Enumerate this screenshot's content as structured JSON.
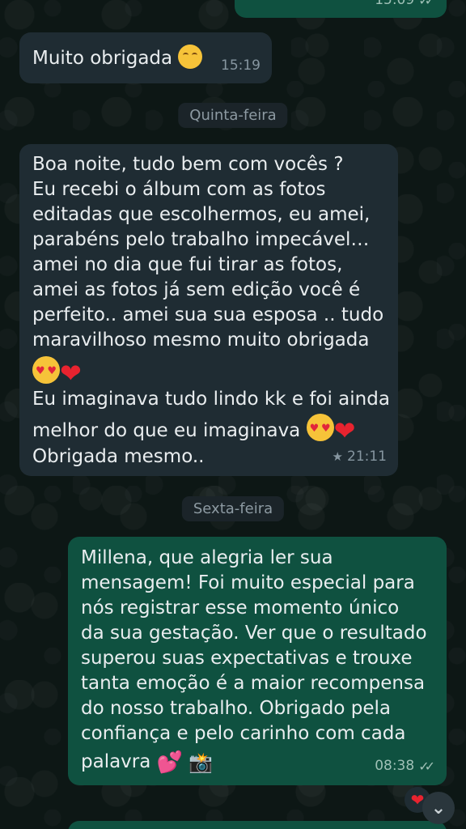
{
  "top_partial": {
    "time": "15:09"
  },
  "msg1": {
    "text": "Muito obrigada",
    "emoji": "smiling-face-icon",
    "time": "15:19"
  },
  "day1": "Quinta-feira",
  "msg2": {
    "lines": [
      "Boa noite, tudo bem com vocês ?",
      "Eu recebi o álbum com as fotos",
      "editadas que escolhermos, eu amei,",
      "parabéns pelo trabalho impecável…",
      "amei no dia que fui tirar as fotos,",
      "amei as fotos já sem edição você é",
      "perfeito.. amei sua sua esposa .. tudo",
      "maravilhoso mesmo muito obrigada"
    ],
    "line9": "Eu imaginava tudo lindo kk e foi ainda",
    "line10": "melhor do que eu imaginava",
    "line11": "Obrigada mesmo..",
    "time": "21:11",
    "starred": true
  },
  "day2": "Sexta-feira",
  "msg3": {
    "lines": [
      "Millena, que alegria ler sua",
      "mensagem! Foi muito especial para",
      "nós registrar esse momento único",
      "da sua gestação. Ver que o resultado",
      "superou suas expectativas e trouxe",
      "tanta emoção é a maior recompensa",
      "do nosso trabalho. Obrigado pela",
      "confiança e pelo carinho com cada"
    ],
    "last_line": "palavra",
    "time": "08:38",
    "status": "read"
  },
  "reaction": "heart",
  "colors": {
    "incoming_bubble": "#1f2c33",
    "outgoing_bubble": "#0f5140",
    "text": "#e9edef",
    "meta": "#8696a0"
  }
}
